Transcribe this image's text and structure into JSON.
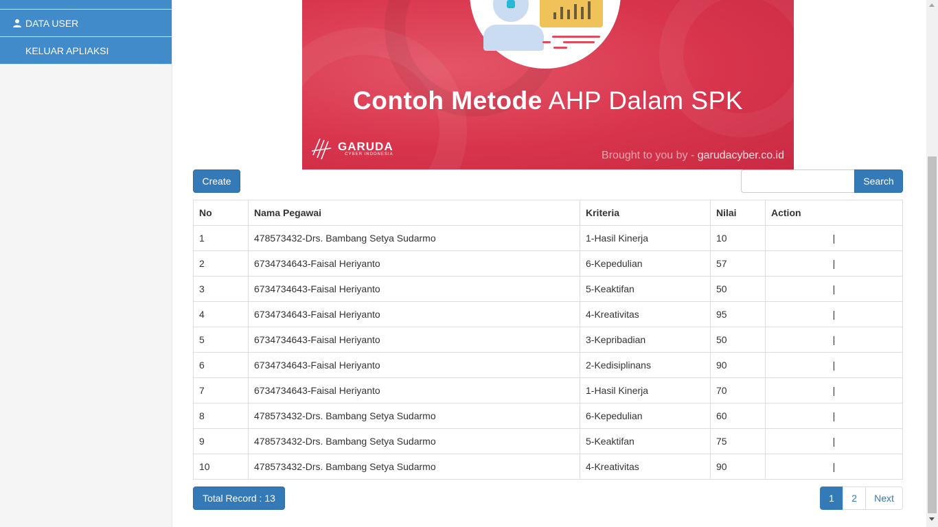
{
  "sidebar": {
    "items": [
      {
        "label": "DATA USER",
        "icon": "user-icon"
      },
      {
        "label": "KELUAR APLIAKSI"
      }
    ]
  },
  "banner": {
    "title_bold": "Contoh Metode",
    "title_rest": " AHP Dalam SPK",
    "logo_name": "GARUDA",
    "logo_sub": "CYBER INDONESIA",
    "brought_prefix": "Brought to you by - ",
    "brought_site": "garudacyber.co.id"
  },
  "toolbar": {
    "create_label": "Create",
    "search_placeholder": "",
    "search_label": "Search"
  },
  "table": {
    "headers": {
      "no": "No",
      "nama": "Nama Pegawai",
      "kriteria": "Kriteria",
      "nilai": "Nilai",
      "action": "Action"
    },
    "rows": [
      {
        "no": "1",
        "nama": "478573432-Drs. Bambang Setya Sudarmo",
        "kriteria": "1-Hasil Kinerja",
        "nilai": "10",
        "action": "|"
      },
      {
        "no": "2",
        "nama": "6734734643-Faisal Heriyanto",
        "kriteria": "6-Kepedulian",
        "nilai": "57",
        "action": "|"
      },
      {
        "no": "3",
        "nama": "6734734643-Faisal Heriyanto",
        "kriteria": "5-Keaktifan",
        "nilai": "50",
        "action": "|"
      },
      {
        "no": "4",
        "nama": "6734734643-Faisal Heriyanto",
        "kriteria": "4-Kreativitas",
        "nilai": "95",
        "action": "|"
      },
      {
        "no": "5",
        "nama": "6734734643-Faisal Heriyanto",
        "kriteria": "3-Kepribadian",
        "nilai": "50",
        "action": "|"
      },
      {
        "no": "6",
        "nama": "6734734643-Faisal Heriyanto",
        "kriteria": "2-Kedisiplinans",
        "nilai": "90",
        "action": "|"
      },
      {
        "no": "7",
        "nama": "6734734643-Faisal Heriyanto",
        "kriteria": "1-Hasil Kinerja",
        "nilai": "70",
        "action": "|"
      },
      {
        "no": "8",
        "nama": "478573432-Drs. Bambang Setya Sudarmo",
        "kriteria": "6-Kepedulian",
        "nilai": "60",
        "action": "|"
      },
      {
        "no": "9",
        "nama": "478573432-Drs. Bambang Setya Sudarmo",
        "kriteria": "5-Keaktifan",
        "nilai": "75",
        "action": "|"
      },
      {
        "no": "10",
        "nama": "478573432-Drs. Bambang Setya Sudarmo",
        "kriteria": "4-Kreativitas",
        "nilai": "90",
        "action": "|"
      }
    ]
  },
  "footer": {
    "total_label": "Total Record : 13",
    "pages": [
      "1",
      "2"
    ],
    "active_page": "1",
    "next_label": "Next"
  },
  "colors": {
    "primary": "#337ab7",
    "sidebar_item": "#428bca",
    "banner": "#d8354d"
  }
}
